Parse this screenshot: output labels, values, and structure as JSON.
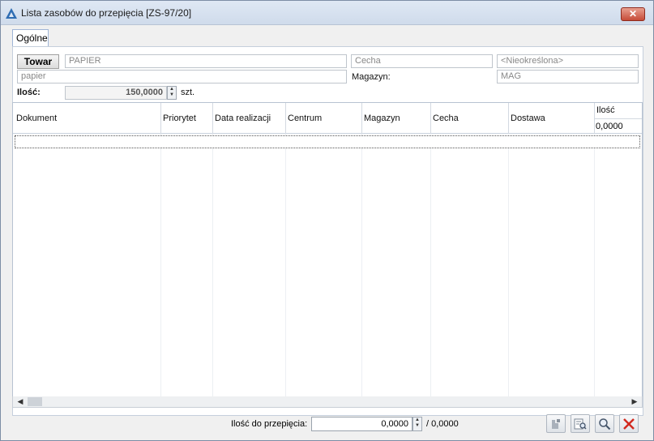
{
  "window": {
    "title": "Lista zasobów do przepięcia [ZS-97/20]",
    "close_label": "✕"
  },
  "tabs": [
    {
      "label": "Ogólne"
    }
  ],
  "towar": {
    "button_label": "Towar",
    "code": "PAPIER",
    "name": "papier",
    "cecha_placeholder": "Cecha",
    "cecha_value": "<Nieokreślona>",
    "magazyn_label": "Magazyn:",
    "magazyn_value": "MAG"
  },
  "ilosc": {
    "label": "Ilość:",
    "value": "150,0000",
    "unit": "szt."
  },
  "grid": {
    "columns": [
      "Dokument",
      "Priorytet",
      "Data realizacji",
      "Centrum",
      "Magazyn",
      "Cecha",
      "Dostawa",
      "Ilość"
    ],
    "ilosc_total": "0,0000"
  },
  "footer": {
    "label": "Ilość do przepięcia:",
    "value": "0,0000",
    "total": "/ 0,0000"
  },
  "colors": {
    "accent": "#2f6db3",
    "close": "#c64b37"
  }
}
